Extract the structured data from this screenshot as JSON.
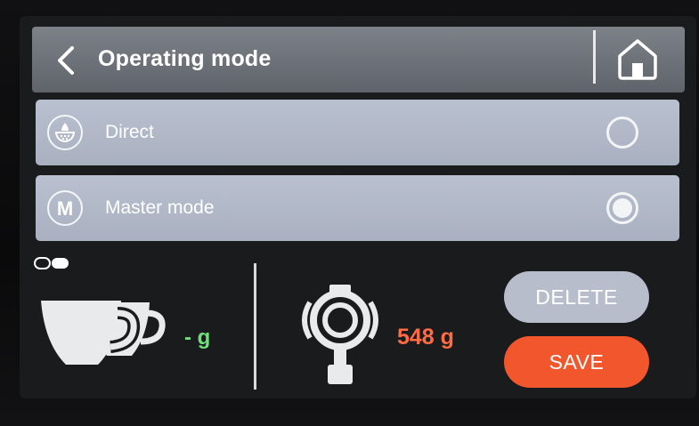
{
  "header": {
    "title": "Operating mode"
  },
  "options": [
    {
      "label": "Direct",
      "icon": "direct-brew-icon",
      "selected": false
    },
    {
      "label": "Master mode",
      "icon": "master-mode-icon",
      "selected": true
    }
  ],
  "bottom": {
    "cup_value": "- g",
    "portafilter_value": "548 g",
    "delete_label": "DELETE",
    "save_label": "SAVE"
  },
  "colors": {
    "accent_save": "#f2562c",
    "cup_value": "#6ee07a",
    "portafilter_value": "#ff6b42"
  }
}
